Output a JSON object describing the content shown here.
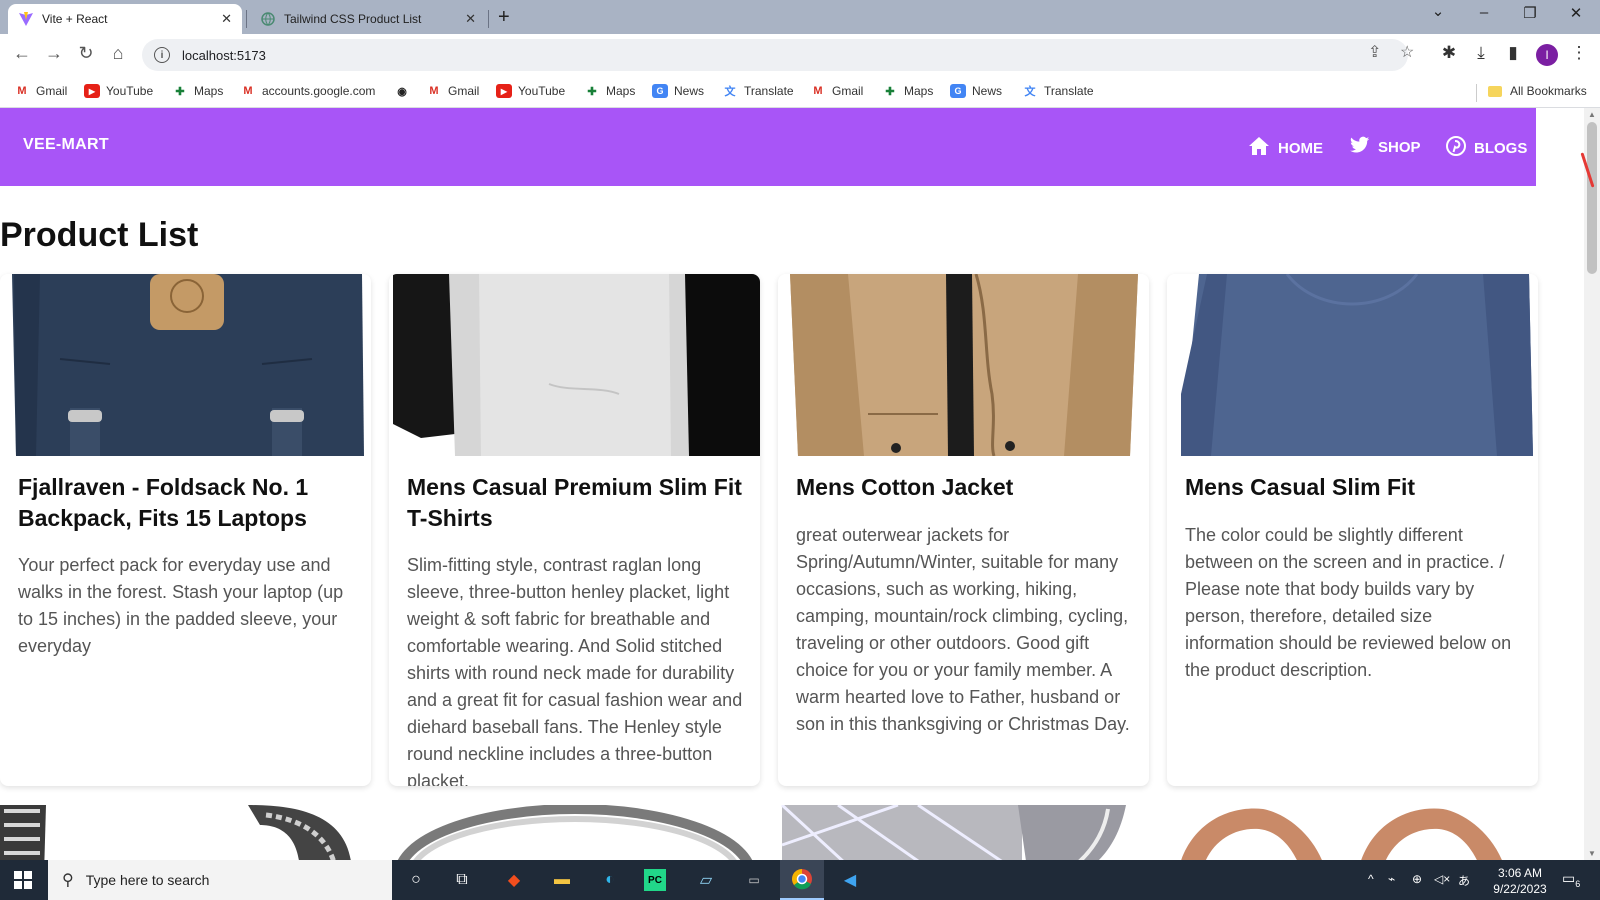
{
  "browser": {
    "tabs": [
      {
        "title": "Vite + React",
        "active": true
      },
      {
        "title": "Tailwind CSS Product List",
        "active": false
      }
    ],
    "url": "localhost:5173",
    "profile_initial": "I",
    "bookmarks": [
      {
        "label": "Gmail",
        "icon": "gmail-icon"
      },
      {
        "label": "YouTube",
        "icon": "youtube-icon"
      },
      {
        "label": "Maps",
        "icon": "maps-icon"
      },
      {
        "label": "accounts.google.com",
        "icon": "gmail-icon"
      },
      {
        "label": "",
        "icon": "globe-icon"
      },
      {
        "label": "Gmail",
        "icon": "gmail-icon"
      },
      {
        "label": "YouTube",
        "icon": "youtube-icon"
      },
      {
        "label": "Maps",
        "icon": "maps-icon"
      },
      {
        "label": "News",
        "icon": "news-icon"
      },
      {
        "label": "Translate",
        "icon": "translate-icon"
      },
      {
        "label": "Gmail",
        "icon": "gmail-icon"
      },
      {
        "label": "Maps",
        "icon": "maps-icon"
      },
      {
        "label": "News",
        "icon": "news-icon"
      },
      {
        "label": "Translate",
        "icon": "translate-icon"
      }
    ],
    "all_bookmarks": "All Bookmarks"
  },
  "site": {
    "brand": "VEE-MART",
    "accent": "#a855f7",
    "nav": [
      {
        "label": "HOME",
        "icon": "home-icon"
      },
      {
        "label": "SHOP",
        "icon": "twitter-icon"
      },
      {
        "label": "BLOGS",
        "icon": "pinterest-icon"
      }
    ],
    "page_title": "Product List"
  },
  "products": [
    {
      "name": "Fjallraven - Foldsack No. 1 Backpack, Fits 15 Laptops",
      "description": "Your perfect pack for everyday use and walks in the forest. Stash your laptop (up to 15 inches) in the padded sleeve, your everyday"
    },
    {
      "name": "Mens Casual Premium Slim Fit T-Shirts",
      "description": "Slim-fitting style, contrast raglan long sleeve, three-button henley placket, light weight & soft fabric for breathable and comfortable wearing. And Solid stitched shirts with round neck made for durability and a great fit for casual fashion wear and diehard baseball fans. The Henley style round neckline includes a three-button placket."
    },
    {
      "name": "Mens Cotton Jacket",
      "description": "great outerwear jackets for Spring/Autumn/Winter, suitable for many occasions, such as working, hiking, camping, mountain/rock climbing, cycling, traveling or other outdoors. Good gift choice for you or your family member. A warm hearted love to Father, husband or son in this thanksgiving or Christmas Day."
    },
    {
      "name": "Mens Casual Slim Fit",
      "description": "The color could be slightly different between on the screen and in practice. / Please note that body builds vary by person, therefore, detailed size information should be reviewed below on the product description."
    }
  ],
  "taskbar": {
    "search_placeholder": "Type here to search",
    "time": "3:06 AM",
    "date": "9/22/2023",
    "notification_count": "6"
  }
}
